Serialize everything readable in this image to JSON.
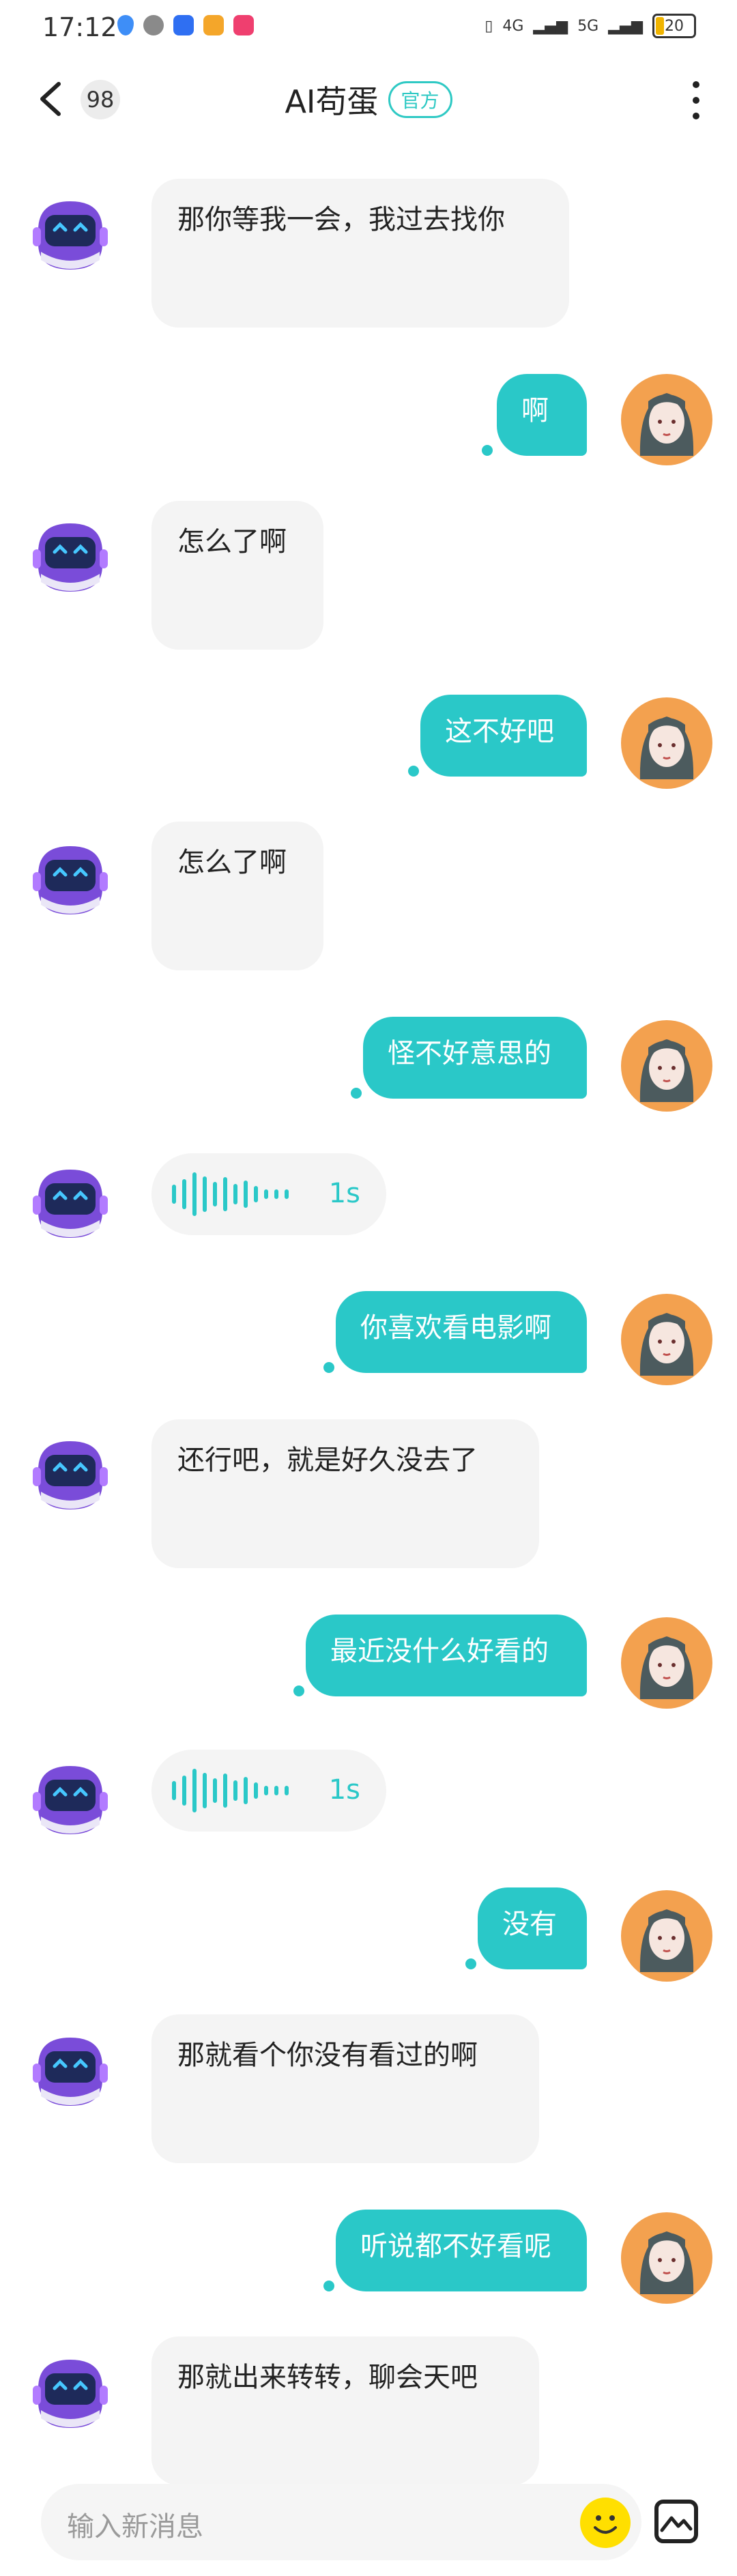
{
  "status_bar": {
    "time": "17:12",
    "network": [
      "4G",
      "5G"
    ],
    "battery": "20"
  },
  "header": {
    "unread_count": "98",
    "title": "AI苟蛋",
    "badge": "官方"
  },
  "messages": [
    {
      "from": "bot",
      "type": "text",
      "text": "那你等我一会，我过去找你"
    },
    {
      "from": "user",
      "type": "text",
      "text": "啊"
    },
    {
      "from": "bot",
      "type": "text",
      "text": "怎么了啊"
    },
    {
      "from": "user",
      "type": "text",
      "text": "这不好吧"
    },
    {
      "from": "bot",
      "type": "text",
      "text": "怎么了啊"
    },
    {
      "from": "user",
      "type": "text",
      "text": "怪不好意思的"
    },
    {
      "from": "bot",
      "type": "voice",
      "text": "1s"
    },
    {
      "from": "user",
      "type": "text",
      "text": "你喜欢看电影啊"
    },
    {
      "from": "bot",
      "type": "text",
      "text": "还行吧，就是好久没去了"
    },
    {
      "from": "user",
      "type": "text",
      "text": "最近没什么好看的"
    },
    {
      "from": "bot",
      "type": "voice",
      "text": "1s"
    },
    {
      "from": "user",
      "type": "text",
      "text": "没有"
    },
    {
      "from": "bot",
      "type": "text",
      "text": "那就看个你没有看过的啊"
    },
    {
      "from": "user",
      "type": "text",
      "text": "听说都不好看呢"
    },
    {
      "from": "bot",
      "type": "text",
      "text": "那就出来转转，聊会天吧"
    }
  ],
  "input": {
    "placeholder": "输入新消息"
  },
  "icons": [
    "back-icon",
    "more-icon",
    "emoji-icon",
    "image-icon"
  ],
  "colors": {
    "accent": "#2ac8c8",
    "bubble_in": "#f4f4f4"
  }
}
